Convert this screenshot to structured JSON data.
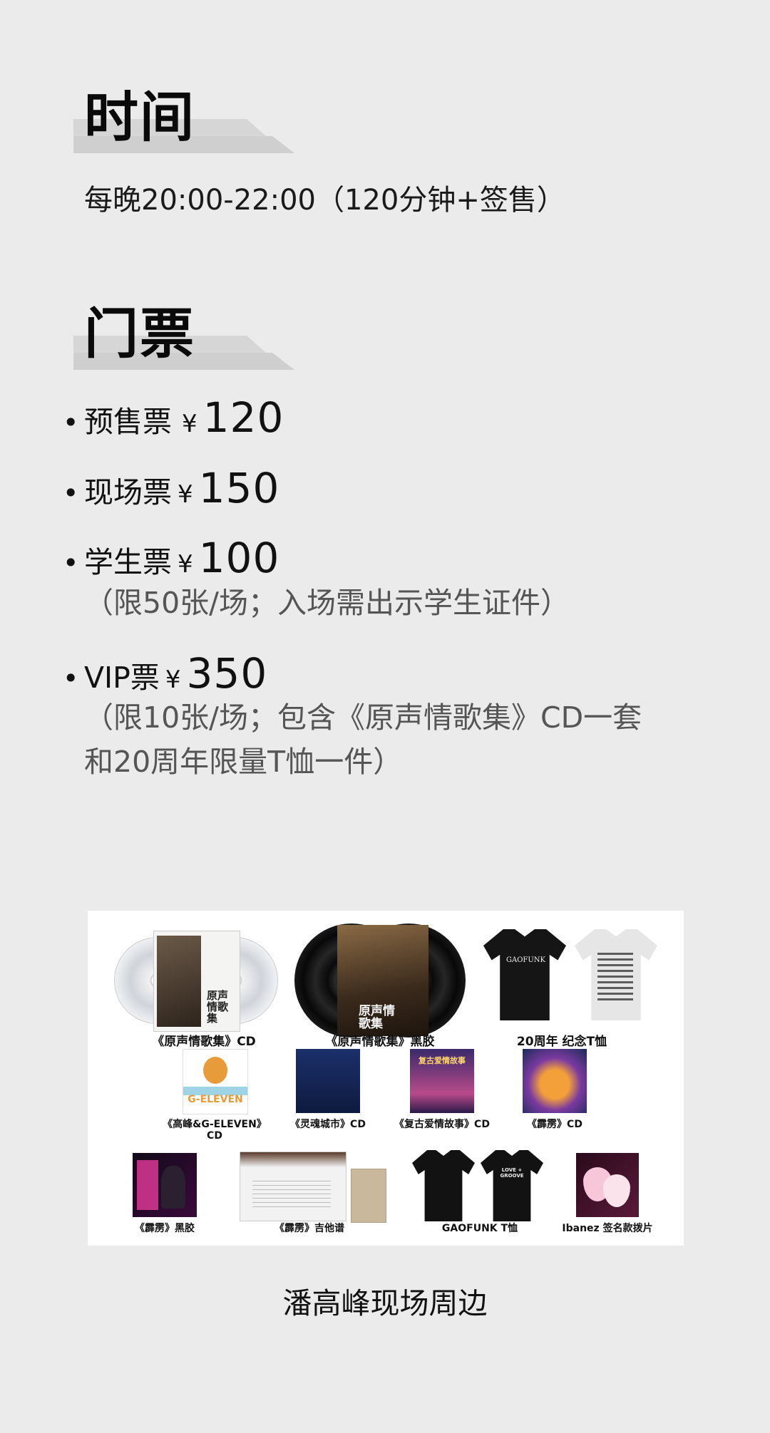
{
  "time_section": {
    "title": "时间",
    "text": "每晚20:00-22:00（120分钟+签售）"
  },
  "ticket_section": {
    "title": "门票",
    "tickets": [
      {
        "name": "预售票",
        "currency": "¥",
        "price": "120"
      },
      {
        "name": "现场票",
        "currency": "¥",
        "price": "150",
        "note_lines": []
      },
      {
        "name": "学生票",
        "currency": "¥",
        "price": "100",
        "note_lines": [
          "（限50张/场；入场需出示学生证件）"
        ]
      },
      {
        "name": "VIP票",
        "currency": "¥",
        "price": "350",
        "note_lines": [
          "（限10张/场；包含《原声情歌集》CD一套",
          "和20周年限量T恤一件）"
        ]
      }
    ]
  },
  "merch": {
    "items": [
      {
        "caption": "《原声情歌集》CD",
        "kind": "cd",
        "cover_text": "原声情歌集"
      },
      {
        "caption": "《原声情歌集》黑胶",
        "kind": "vinyl",
        "cover_text": "原声情歌集"
      },
      {
        "caption": "20周年 纪念T恤",
        "kind": "tee-pair",
        "tee_text": "GAOFUNK"
      },
      {
        "caption": "《高峰&G-ELEVEN》",
        "caption2": "CD",
        "kind": "cover",
        "cover_text": "G-ELEVEN"
      },
      {
        "caption": "《灵魂城市》CD",
        "kind": "cover"
      },
      {
        "caption": "《复古爱情故事》CD",
        "kind": "cover",
        "cover_text": "复古爱情故事"
      },
      {
        "caption": "《霹雳》CD",
        "kind": "cover"
      },
      {
        "caption": "《霹雳》黑胶",
        "kind": "cover"
      },
      {
        "caption": "《霹雳》吉他谱",
        "kind": "book"
      },
      {
        "caption": "GAOFUNK T恤",
        "kind": "tee-pair-black",
        "tee_text": "LOVE + GROOVE"
      },
      {
        "caption": "Ibanez 签名款拨片",
        "kind": "picks"
      }
    ]
  },
  "merch_title": "潘高峰现场周边",
  "colors": {
    "background": "#ebebeb",
    "text": "#111111",
    "note_text": "#555555",
    "title_bar": "#d6d6d6"
  }
}
